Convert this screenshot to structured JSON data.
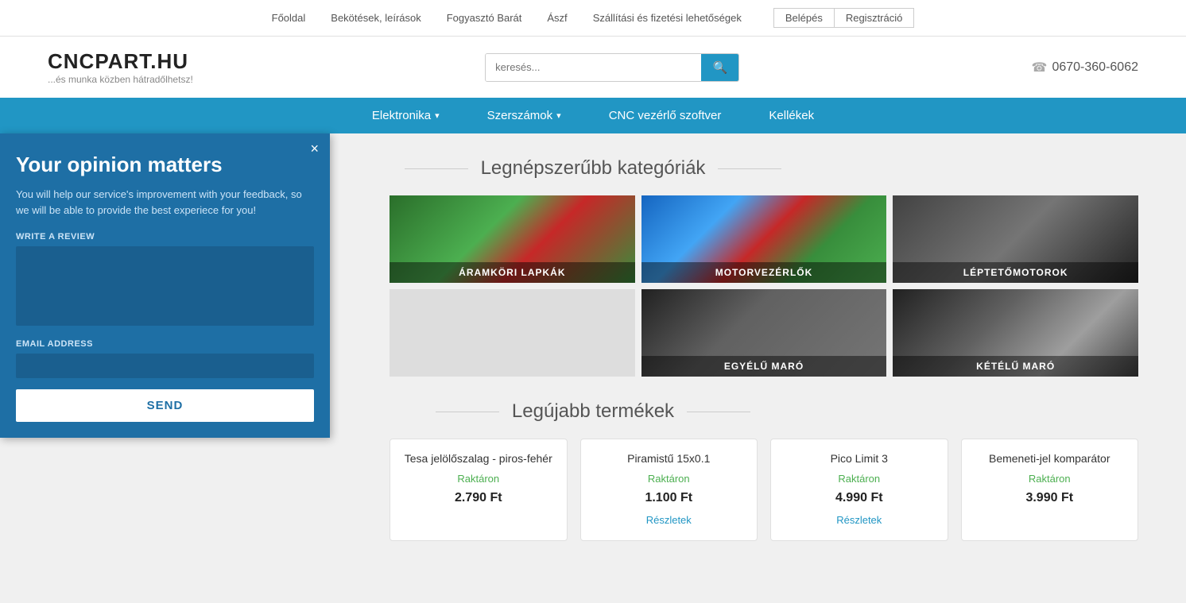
{
  "topnav": {
    "links": [
      {
        "label": "Főoldal",
        "href": "#"
      },
      {
        "label": "Bekötések, leírások",
        "href": "#"
      },
      {
        "label": "Fogyasztó Barát",
        "href": "#"
      },
      {
        "label": "Ászf",
        "href": "#"
      },
      {
        "label": "Szállítási és fizetési lehetőségek",
        "href": "#"
      }
    ],
    "login_label": "Belépés",
    "register_label": "Regisztráció"
  },
  "header": {
    "logo_title": "CNCPART.HU",
    "logo_sub": "...és munka közben hátradőlhetsz!",
    "search_placeholder": "keresés...",
    "phone": "0670-360-6062"
  },
  "mainnav": {
    "items": [
      {
        "label": "Elektronika",
        "has_dropdown": true
      },
      {
        "label": "Szerszámok",
        "has_dropdown": true
      },
      {
        "label": "CNC vezérlő szoftver",
        "has_dropdown": false
      },
      {
        "label": "Kellékek",
        "has_dropdown": false
      }
    ]
  },
  "popular_section": {
    "title": "Legnépszerűbb kategóriák"
  },
  "categories": [
    {
      "label": "ÁRAMKÖRI LAPKÁK",
      "bg_class": "cat-circuits"
    },
    {
      "label": "MOTORVEZÉRLŐK",
      "bg_class": "cat-motors"
    },
    {
      "label": "LÉPTETŐMOTOROK",
      "bg_class": "cat-stepper"
    },
    {
      "label": "EGYÉLŰ MARÓ",
      "bg_class": "cat-single"
    },
    {
      "label": "KÉTÉLŰ MARÓ",
      "bg_class": "cat-double"
    }
  ],
  "latest_section": {
    "title": "Legújabb termékek"
  },
  "products": [
    {
      "name": "Tesa jelölőszalag - piros-fehér",
      "stock": "Raktáron",
      "price": "2.790 Ft",
      "has_link": false
    },
    {
      "name": "Piramistű 15x0.1",
      "stock": "Raktáron",
      "price": "1.100 Ft",
      "link_label": "Részletek",
      "has_link": true
    },
    {
      "name": "Pico Limit 3",
      "stock": "Raktáron",
      "price": "4.990 Ft",
      "link_label": "Részletek",
      "has_link": true
    },
    {
      "name": "Bemeneti-jel komparátor",
      "stock": "Raktáron",
      "price": "3.990 Ft",
      "has_link": false
    }
  ],
  "popup": {
    "title": "Your opinion matters",
    "description": "You will help our service's improvement with your feedback, so we will be able to provide the best experiece for you!",
    "review_label": "WRITE A REVIEW",
    "email_label": "EMAIL ADDRESS",
    "send_label": "SEND",
    "close_label": "×"
  }
}
